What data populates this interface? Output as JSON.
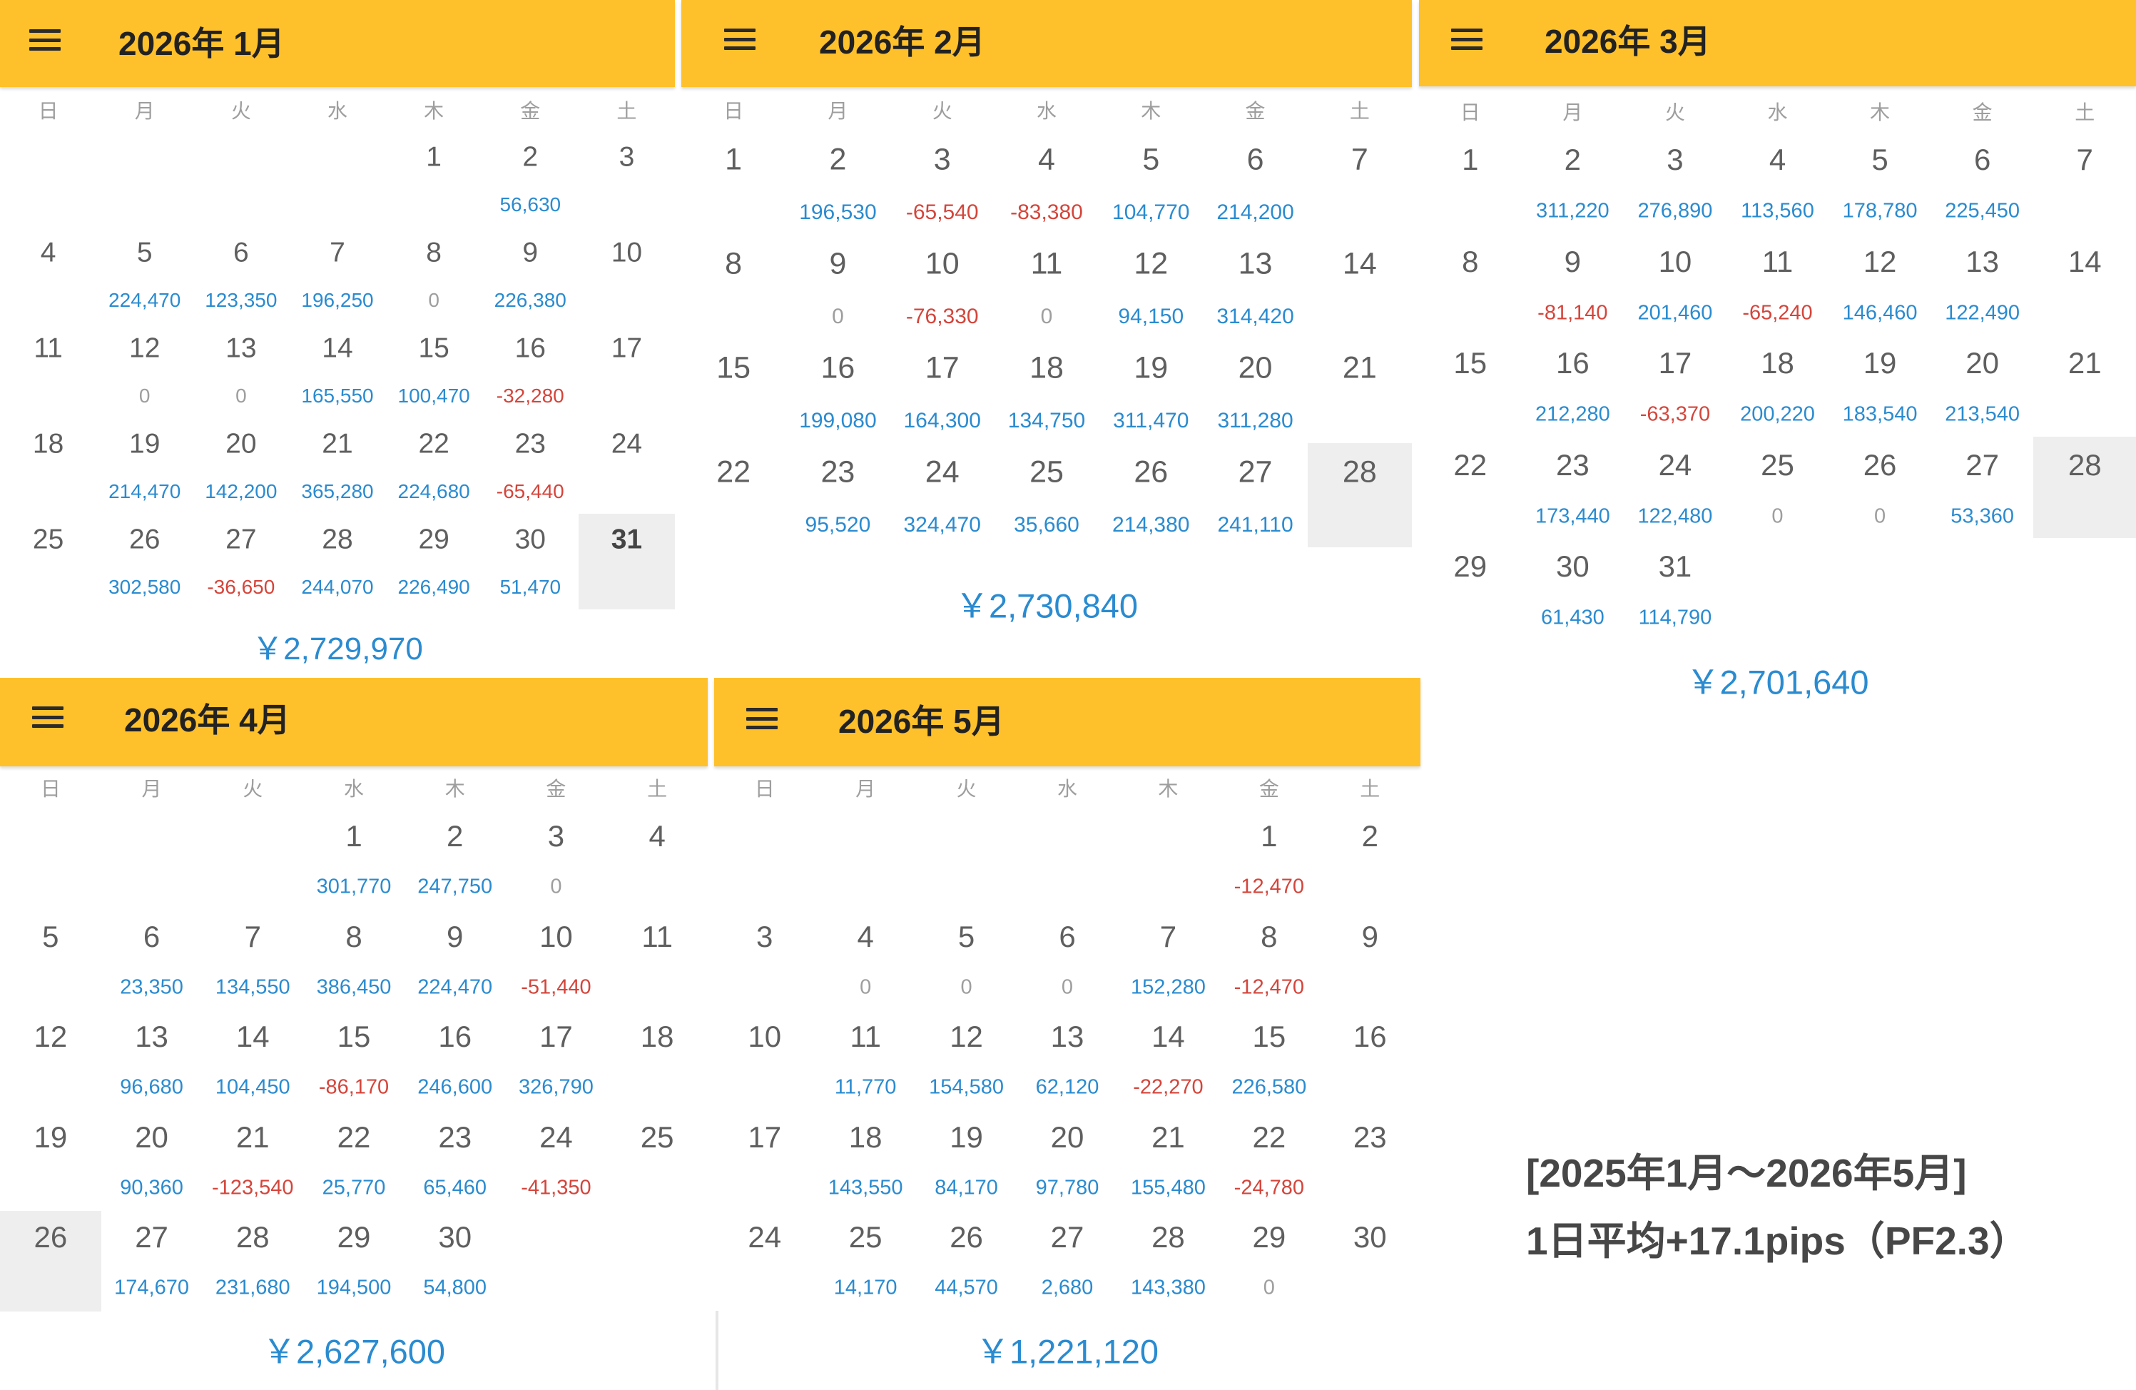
{
  "weekdays": [
    "日",
    "月",
    "火",
    "水",
    "木",
    "金",
    "土"
  ],
  "colors": {
    "header": "#FFC12B",
    "positive": "#2A8BD0",
    "negative": "#D4453B",
    "zero": "#9E9E9E",
    "total": "#2A8BD0",
    "highlight": "#EEEEEE"
  },
  "icons": {
    "menu": "hamburger-menu-icon"
  },
  "months": [
    {
      "title": "2026年 1月",
      "total": "￥2,729,970",
      "weeks": [
        [
          null,
          null,
          null,
          null,
          {
            "day": "1"
          },
          {
            "day": "2",
            "pnl": "56,630"
          },
          {
            "day": "3"
          }
        ],
        [
          {
            "day": "4"
          },
          {
            "day": "5",
            "pnl": "224,470"
          },
          {
            "day": "6",
            "pnl": "123,350"
          },
          {
            "day": "7",
            "pnl": "196,250"
          },
          {
            "day": "8",
            "pnl": "0"
          },
          {
            "day": "9",
            "pnl": "226,380"
          },
          {
            "day": "10"
          }
        ],
        [
          {
            "day": "11"
          },
          {
            "day": "12",
            "pnl": "0"
          },
          {
            "day": "13",
            "pnl": "0"
          },
          {
            "day": "14",
            "pnl": "165,550"
          },
          {
            "day": "15",
            "pnl": "100,470"
          },
          {
            "day": "16",
            "pnl": "-32,280"
          },
          {
            "day": "17"
          }
        ],
        [
          {
            "day": "18"
          },
          {
            "day": "19",
            "pnl": "214,470"
          },
          {
            "day": "20",
            "pnl": "142,200"
          },
          {
            "day": "21",
            "pnl": "365,280"
          },
          {
            "day": "22",
            "pnl": "224,680"
          },
          {
            "day": "23",
            "pnl": "-65,440"
          },
          {
            "day": "24"
          }
        ],
        [
          {
            "day": "25"
          },
          {
            "day": "26",
            "pnl": "302,580"
          },
          {
            "day": "27",
            "pnl": "-36,650"
          },
          {
            "day": "28",
            "pnl": "244,070"
          },
          {
            "day": "29",
            "pnl": "226,490"
          },
          {
            "day": "30",
            "pnl": "51,470"
          },
          {
            "day": "31",
            "highlighted": true,
            "bold": true
          }
        ]
      ]
    },
    {
      "title": "2026年 2月",
      "total": "￥2,730,840",
      "weeks": [
        [
          {
            "day": "1"
          },
          {
            "day": "2",
            "pnl": "196,530"
          },
          {
            "day": "3",
            "pnl": "-65,540"
          },
          {
            "day": "4",
            "pnl": "-83,380"
          },
          {
            "day": "5",
            "pnl": "104,770"
          },
          {
            "day": "6",
            "pnl": "214,200"
          },
          {
            "day": "7"
          }
        ],
        [
          {
            "day": "8"
          },
          {
            "day": "9",
            "pnl": "0"
          },
          {
            "day": "10",
            "pnl": "-76,330"
          },
          {
            "day": "11",
            "pnl": "0"
          },
          {
            "day": "12",
            "pnl": "94,150"
          },
          {
            "day": "13",
            "pnl": "314,420"
          },
          {
            "day": "14"
          }
        ],
        [
          {
            "day": "15"
          },
          {
            "day": "16",
            "pnl": "199,080"
          },
          {
            "day": "17",
            "pnl": "164,300"
          },
          {
            "day": "18",
            "pnl": "134,750"
          },
          {
            "day": "19",
            "pnl": "311,470"
          },
          {
            "day": "20",
            "pnl": "311,280"
          },
          {
            "day": "21"
          }
        ],
        [
          {
            "day": "22"
          },
          {
            "day": "23",
            "pnl": "95,520"
          },
          {
            "day": "24",
            "pnl": "324,470"
          },
          {
            "day": "25",
            "pnl": "35,660"
          },
          {
            "day": "26",
            "pnl": "214,380"
          },
          {
            "day": "27",
            "pnl": "241,110"
          },
          {
            "day": "28",
            "highlighted": true
          }
        ]
      ]
    },
    {
      "title": "2026年 3月",
      "total": "￥2,701,640",
      "weeks": [
        [
          {
            "day": "1"
          },
          {
            "day": "2",
            "pnl": "311,220"
          },
          {
            "day": "3",
            "pnl": "276,890"
          },
          {
            "day": "4",
            "pnl": "113,560"
          },
          {
            "day": "5",
            "pnl": "178,780"
          },
          {
            "day": "6",
            "pnl": "225,450"
          },
          {
            "day": "7"
          }
        ],
        [
          {
            "day": "8"
          },
          {
            "day": "9",
            "pnl": "-81,140"
          },
          {
            "day": "10",
            "pnl": "201,460"
          },
          {
            "day": "11",
            "pnl": "-65,240"
          },
          {
            "day": "12",
            "pnl": "146,460"
          },
          {
            "day": "13",
            "pnl": "122,490"
          },
          {
            "day": "14"
          }
        ],
        [
          {
            "day": "15"
          },
          {
            "day": "16",
            "pnl": "212,280"
          },
          {
            "day": "17",
            "pnl": "-63,370"
          },
          {
            "day": "18",
            "pnl": "200,220"
          },
          {
            "day": "19",
            "pnl": "183,540"
          },
          {
            "day": "20",
            "pnl": "213,540"
          },
          {
            "day": "21"
          }
        ],
        [
          {
            "day": "22"
          },
          {
            "day": "23",
            "pnl": "173,440"
          },
          {
            "day": "24",
            "pnl": "122,480"
          },
          {
            "day": "25",
            "pnl": "0"
          },
          {
            "day": "26",
            "pnl": "0"
          },
          {
            "day": "27",
            "pnl": "53,360"
          },
          {
            "day": "28",
            "highlighted": true
          }
        ],
        [
          {
            "day": "29"
          },
          {
            "day": "30",
            "pnl": "61,430"
          },
          {
            "day": "31",
            "pnl": "114,790"
          },
          null,
          null,
          null,
          null
        ]
      ]
    },
    {
      "title": "2026年 4月",
      "total": "￥2,627,600",
      "weeks": [
        [
          null,
          null,
          null,
          {
            "day": "1",
            "pnl": "301,770"
          },
          {
            "day": "2",
            "pnl": "247,750"
          },
          {
            "day": "3",
            "pnl": "0"
          },
          {
            "day": "4"
          }
        ],
        [
          {
            "day": "5"
          },
          {
            "day": "6",
            "pnl": "23,350"
          },
          {
            "day": "7",
            "pnl": "134,550"
          },
          {
            "day": "8",
            "pnl": "386,450"
          },
          {
            "day": "9",
            "pnl": "224,470"
          },
          {
            "day": "10",
            "pnl": "-51,440"
          },
          {
            "day": "11"
          }
        ],
        [
          {
            "day": "12"
          },
          {
            "day": "13",
            "pnl": "96,680"
          },
          {
            "day": "14",
            "pnl": "104,450"
          },
          {
            "day": "15",
            "pnl": "-86,170"
          },
          {
            "day": "16",
            "pnl": "246,600"
          },
          {
            "day": "17",
            "pnl": "326,790"
          },
          {
            "day": "18"
          }
        ],
        [
          {
            "day": "19"
          },
          {
            "day": "20",
            "pnl": "90,360"
          },
          {
            "day": "21",
            "pnl": "-123,540"
          },
          {
            "day": "22",
            "pnl": "25,770"
          },
          {
            "day": "23",
            "pnl": "65,460"
          },
          {
            "day": "24",
            "pnl": "-41,350"
          },
          {
            "day": "25"
          }
        ],
        [
          {
            "day": "26",
            "highlighted": true
          },
          {
            "day": "27",
            "pnl": "174,670"
          },
          {
            "day": "28",
            "pnl": "231,680"
          },
          {
            "day": "29",
            "pnl": "194,500"
          },
          {
            "day": "30",
            "pnl": "54,800"
          },
          null,
          null
        ]
      ]
    },
    {
      "title": "2026年 5月",
      "total": "￥1,221,120",
      "weeks": [
        [
          null,
          null,
          null,
          null,
          null,
          {
            "day": "1",
            "pnl": "-12,470"
          },
          {
            "day": "2"
          }
        ],
        [
          {
            "day": "3"
          },
          {
            "day": "4",
            "pnl": "0"
          },
          {
            "day": "5",
            "pnl": "0"
          },
          {
            "day": "6",
            "pnl": "0"
          },
          {
            "day": "7",
            "pnl": "152,280"
          },
          {
            "day": "8",
            "pnl": "-12,470"
          },
          {
            "day": "9"
          }
        ],
        [
          {
            "day": "10"
          },
          {
            "day": "11",
            "pnl": "11,770"
          },
          {
            "day": "12",
            "pnl": "154,580"
          },
          {
            "day": "13",
            "pnl": "62,120"
          },
          {
            "day": "14",
            "pnl": "-22,270"
          },
          {
            "day": "15",
            "pnl": "226,580"
          },
          {
            "day": "16"
          }
        ],
        [
          {
            "day": "17"
          },
          {
            "day": "18",
            "pnl": "143,550"
          },
          {
            "day": "19",
            "pnl": "84,170"
          },
          {
            "day": "20",
            "pnl": "97,780"
          },
          {
            "day": "21",
            "pnl": "155,480"
          },
          {
            "day": "22",
            "pnl": "-24,780"
          },
          {
            "day": "23"
          }
        ],
        [
          {
            "day": "24"
          },
          {
            "day": "25",
            "pnl": "14,170"
          },
          {
            "day": "26",
            "pnl": "44,570"
          },
          {
            "day": "27",
            "pnl": "2,680"
          },
          {
            "day": "28",
            "pnl": "143,380"
          },
          {
            "day": "29",
            "pnl": "0"
          },
          {
            "day": "30"
          }
        ]
      ]
    }
  ],
  "summary": {
    "period": "[2025年1月〜2026年5月]",
    "stats": "1日平均+17.1pips（PF2.3）"
  }
}
